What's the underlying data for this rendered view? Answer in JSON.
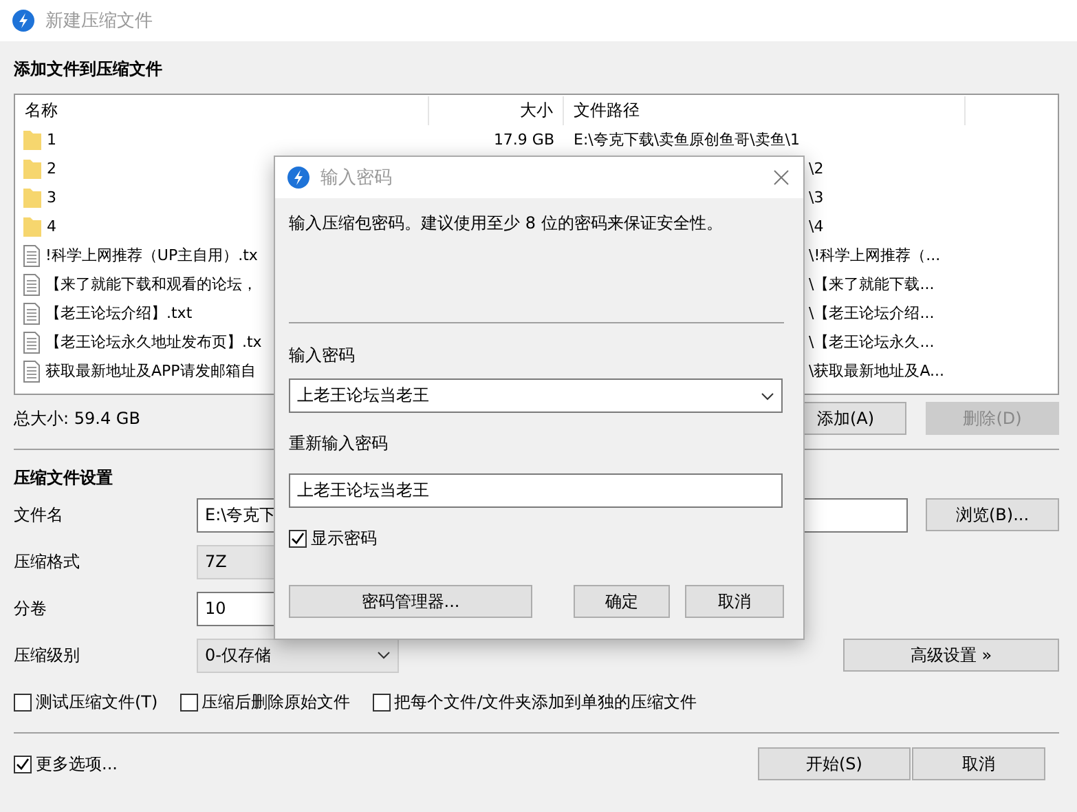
{
  "window": {
    "title": "新建压缩文件"
  },
  "files_section": {
    "heading": "添加文件到压缩文件",
    "columns": [
      "名称",
      "大小",
      "文件路径"
    ],
    "rows": [
      {
        "kind": "folder",
        "name": "1",
        "size": "17.9 GB",
        "path": "E:\\夸克下载\\卖鱼原创鱼哥\\卖鱼\\1"
      },
      {
        "kind": "folder",
        "name": "2",
        "path": "\\2"
      },
      {
        "kind": "folder",
        "name": "3",
        "path": "\\3"
      },
      {
        "kind": "folder",
        "name": "4",
        "path": "\\4"
      },
      {
        "kind": "file",
        "name": "!科学上网推荐（UP主自用）.tx",
        "path": "\\!科学上网推荐（..."
      },
      {
        "kind": "file",
        "name": "【来了就能下载和观看的论坛，",
        "path": "\\【来了就能下载..."
      },
      {
        "kind": "file",
        "name": "【老王论坛介绍】.txt",
        "path": "\\【老王论坛介绍..."
      },
      {
        "kind": "file",
        "name": "【老王论坛永久地址发布页】.tx",
        "path": "\\【老王论坛永久..."
      },
      {
        "kind": "file",
        "name": "获取最新地址及APP请发邮箱自",
        "path": "\\获取最新地址及A..."
      }
    ],
    "total": "总大小: 59.4 GB",
    "buttons": [
      {
        "label": "添加(A)",
        "disabled": false
      },
      {
        "label": "删除(D)",
        "disabled": true
      }
    ]
  },
  "settings": {
    "heading": "压缩文件设置",
    "filename": {
      "label": "文件名",
      "value": "E:\\夸克下"
    },
    "browse": "浏览(B)...",
    "format": {
      "label": "压缩格式",
      "value": "7Z"
    },
    "split": {
      "label": "分卷",
      "value": "10"
    },
    "level": {
      "label": "压缩级别",
      "value": "0-仅存储"
    },
    "advanced": "高级设置 »",
    "options": [
      {
        "label": "测试压缩文件(T)",
        "checked": false
      },
      {
        "label": "压缩后删除原始文件",
        "checked": false
      },
      {
        "label": "把每个文件/文件夹添加到单独的压缩文件",
        "checked": false
      }
    ]
  },
  "footer": {
    "more": {
      "label": "更多选项...",
      "checked": true
    },
    "buttons": [
      "开始(S)",
      "取消"
    ]
  },
  "dialog": {
    "title": "输入密码",
    "message": "输入压缩包密码。建议使用至少 8 位的密码来保证安全性。",
    "password": {
      "label": "输入密码",
      "value": "上老王论坛当老王"
    },
    "confirm": {
      "label": "重新输入密码",
      "value": "上老王论坛当老王"
    },
    "show_password": {
      "label": "显示密码",
      "checked": true
    },
    "buttons": [
      "密码管理器...",
      "确定",
      "取消"
    ]
  }
}
